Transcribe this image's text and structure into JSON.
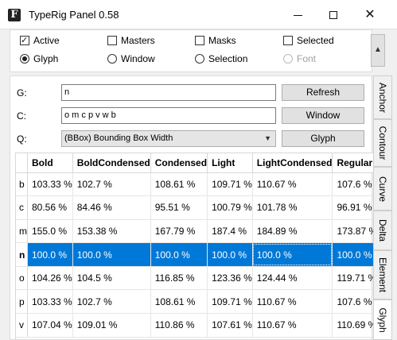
{
  "window": {
    "title": "TypeRig Panel 0.58",
    "app_icon_letter": "F"
  },
  "options": {
    "row1": [
      {
        "label": "Active",
        "checked": true
      },
      {
        "label": "Masters",
        "checked": false
      },
      {
        "label": "Masks",
        "checked": false
      },
      {
        "label": "Selected",
        "checked": false
      }
    ],
    "row2": [
      {
        "label": "Glyph",
        "selected": true
      },
      {
        "label": "Window",
        "selected": false
      },
      {
        "label": "Selection",
        "selected": false
      },
      {
        "label": "Font",
        "selected": false,
        "disabled": true
      }
    ]
  },
  "form": {
    "g_label": "G:",
    "g_value": "n",
    "c_label": "C:",
    "c_value": "o m c p v w b",
    "q_label": "Q:",
    "q_value": "(BBox) Bounding Box Width",
    "refresh_label": "Refresh",
    "window_label": "Window",
    "glyph_label": "Glyph"
  },
  "table": {
    "columns": [
      "Bold",
      "BoldCondensed",
      "Condensed",
      "Light",
      "LightCondensed",
      "Regular"
    ],
    "rows": [
      {
        "glyph": "b",
        "values": [
          "103.33 %",
          "102.7 %",
          "108.61 %",
          "109.71 %",
          "110.67 %",
          "107.6 %"
        ]
      },
      {
        "glyph": "c",
        "values": [
          "80.56 %",
          "84.46 %",
          "95.51 %",
          "100.79 %",
          "101.78 %",
          "96.91 %"
        ]
      },
      {
        "glyph": "m",
        "values": [
          "155.0 %",
          "153.38 %",
          "167.79 %",
          "187.4 %",
          "184.89 %",
          "173.87 %"
        ]
      },
      {
        "glyph": "n",
        "values": [
          "100.0 %",
          "100.0 %",
          "100.0 %",
          "100.0 %",
          "100.0 %",
          "100.0 %"
        ],
        "selected": true
      },
      {
        "glyph": "o",
        "values": [
          "104.26 %",
          "104.5 %",
          "116.85 %",
          "123.36 %",
          "124.44 %",
          "119.71 %"
        ]
      },
      {
        "glyph": "p",
        "values": [
          "103.33 %",
          "102.7 %",
          "108.61 %",
          "109.71 %",
          "110.67 %",
          "107.6 %"
        ]
      },
      {
        "glyph": "v",
        "values": [
          "107.04 %",
          "109.01 %",
          "110.86 %",
          "107.61 %",
          "110.67 %",
          "110.69 %"
        ]
      }
    ]
  },
  "side_tabs": [
    "Anchor",
    "Contour",
    "Curve",
    "Delta",
    "Element",
    "Glyph"
  ],
  "colors": {
    "selection": "#0078d7"
  },
  "icons": {
    "minimize": "minimize-icon",
    "maximize": "maximize-icon",
    "close": "close-icon",
    "collapse": "chevron-up-icon",
    "dropdown": "chevron-down-icon"
  }
}
